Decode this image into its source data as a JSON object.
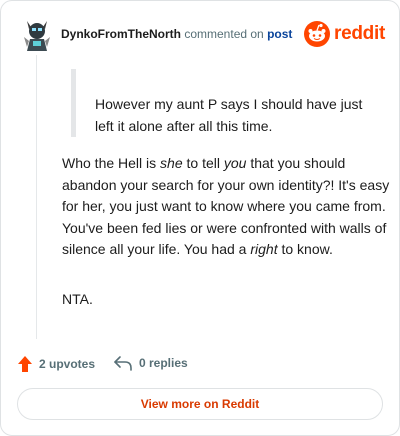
{
  "comment": {
    "author": "DynkoFromTheNorth",
    "action_text": "commented on",
    "post_link": "post",
    "quote": "However my aunt P says I should have just left it alone after all this time.",
    "body": {
      "seg1": "Who the Hell is ",
      "em1": "she",
      "seg2": " to tell ",
      "em2": "you",
      "seg3": " that you should abandon your search for your own identity?! It's easy for her, you just want to know where you came from. You've been fed lies or were confronted with walls of silence all your life. You had a ",
      "em3": "right",
      "seg4": " to know."
    },
    "verdict": "NTA.",
    "upvotes": "2 upvotes",
    "replies": "0 replies"
  },
  "brand": {
    "name": "reddit",
    "color": "#ff4500"
  },
  "view_more_label": "View more on Reddit",
  "icons": {
    "avatar": "avatar",
    "logo": "reddit-logo-icon",
    "upvote": "upvote-arrow-icon",
    "reply": "reply-arrow-icon"
  }
}
